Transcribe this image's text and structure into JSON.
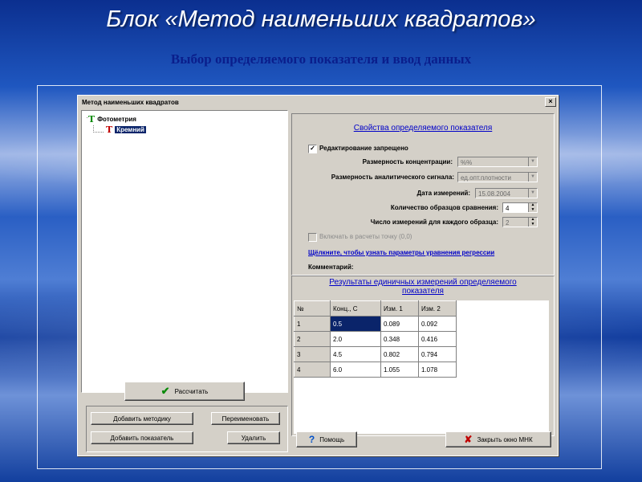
{
  "slide": {
    "title": "Блок «Метод наименьших квадратов»",
    "subtitle": "Выбор определяемого показателя и ввод данных"
  },
  "window": {
    "title": "Метод наименьших квадратов",
    "close_glyph": "×"
  },
  "tree": {
    "root": "Фотометрия",
    "child": "Кремний"
  },
  "left_buttons": {
    "calculate": "Рассчитать",
    "add_method": "Добавить методику",
    "rename": "Переименовать",
    "add_indicator": "Добавить показатель",
    "delete": "Удалить"
  },
  "props": {
    "header": "Свойства определяемого показателя",
    "edit_forbidden": "Редактирование запрещено",
    "conc_dim_label": "Размерность концентрации:",
    "conc_dim_value": "%%",
    "signal_dim_label": "Размерность аналитического сигнала:",
    "signal_dim_value": "ед.опт.плотности",
    "date_label": "Дата измерений:",
    "date_value": "15.08.2004",
    "samples_label": "Количество образцов сравнения:",
    "samples_value": "4",
    "measurements_label": "Число измерений для каждого образца:",
    "measurements_value": "2",
    "include_zero": "Включать в расчеты точку (0,0)",
    "regression_link": "Щёлкните, чтобы узнать параметры уравнения регрессии",
    "comment_label": "Комментарий:"
  },
  "results": {
    "header_line1": "Результаты единичных измерений определяемого",
    "header_line2": "показателя",
    "columns": [
      "№",
      "Конц., С",
      "Изм. 1",
      "Изм. 2"
    ],
    "rows": [
      [
        "1",
        "0.5",
        "0.089",
        "0.092"
      ],
      [
        "2",
        "2.0",
        "0.348",
        "0.416"
      ],
      [
        "3",
        "4.5",
        "0.802",
        "0.794"
      ],
      [
        "4",
        "6.0",
        "1.055",
        "1.078"
      ]
    ]
  },
  "bottom": {
    "help": "Помощь",
    "close": "Закрыть окно МНК"
  }
}
